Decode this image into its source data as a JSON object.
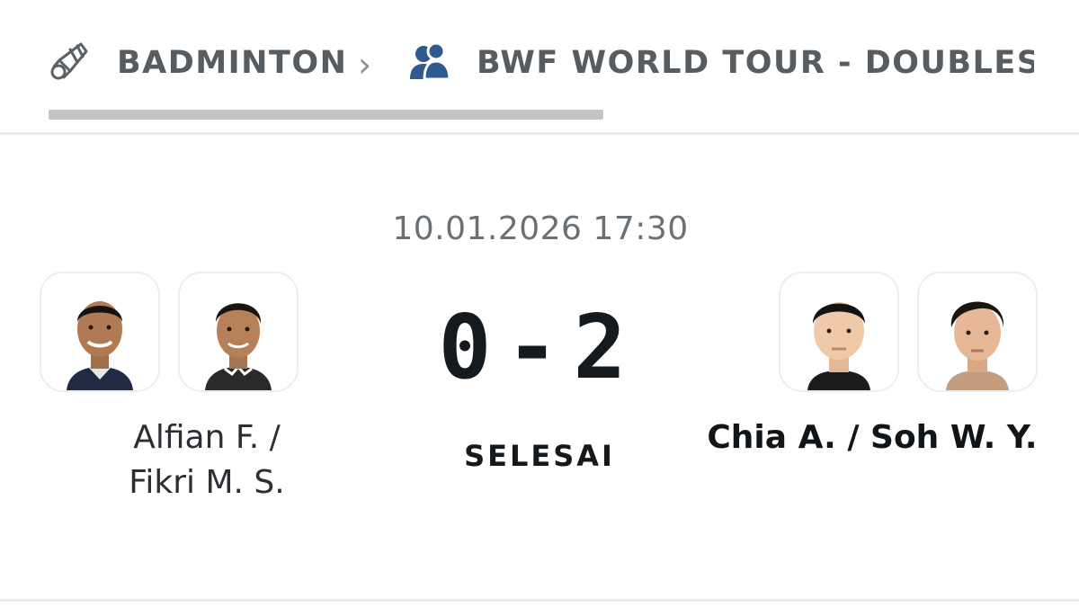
{
  "breadcrumb": {
    "sport_label": "BADMINTON",
    "sport_icon": "shuttlecock-icon",
    "separator_icon": "chevron-right-icon",
    "competition_label": "BWF WORLD TOUR - DOUBLES MEN",
    "competition_icon": "doubles-players-icon"
  },
  "match": {
    "datetime": "10.01.2026 17:30",
    "home_score": "0",
    "score_separator": "-",
    "away_score": "2",
    "status": "SELESAI"
  },
  "home": {
    "name_line1": "Alfian F. /",
    "name_line2": "Fikri M. S."
  },
  "away": {
    "name": "Chia A. / Soh W. Y."
  },
  "colors": {
    "icon_blue": "#2e5a8c",
    "text_dark": "#151a1f",
    "text_grey": "#575c61",
    "scroll_indicator": "#c4c4c4"
  }
}
